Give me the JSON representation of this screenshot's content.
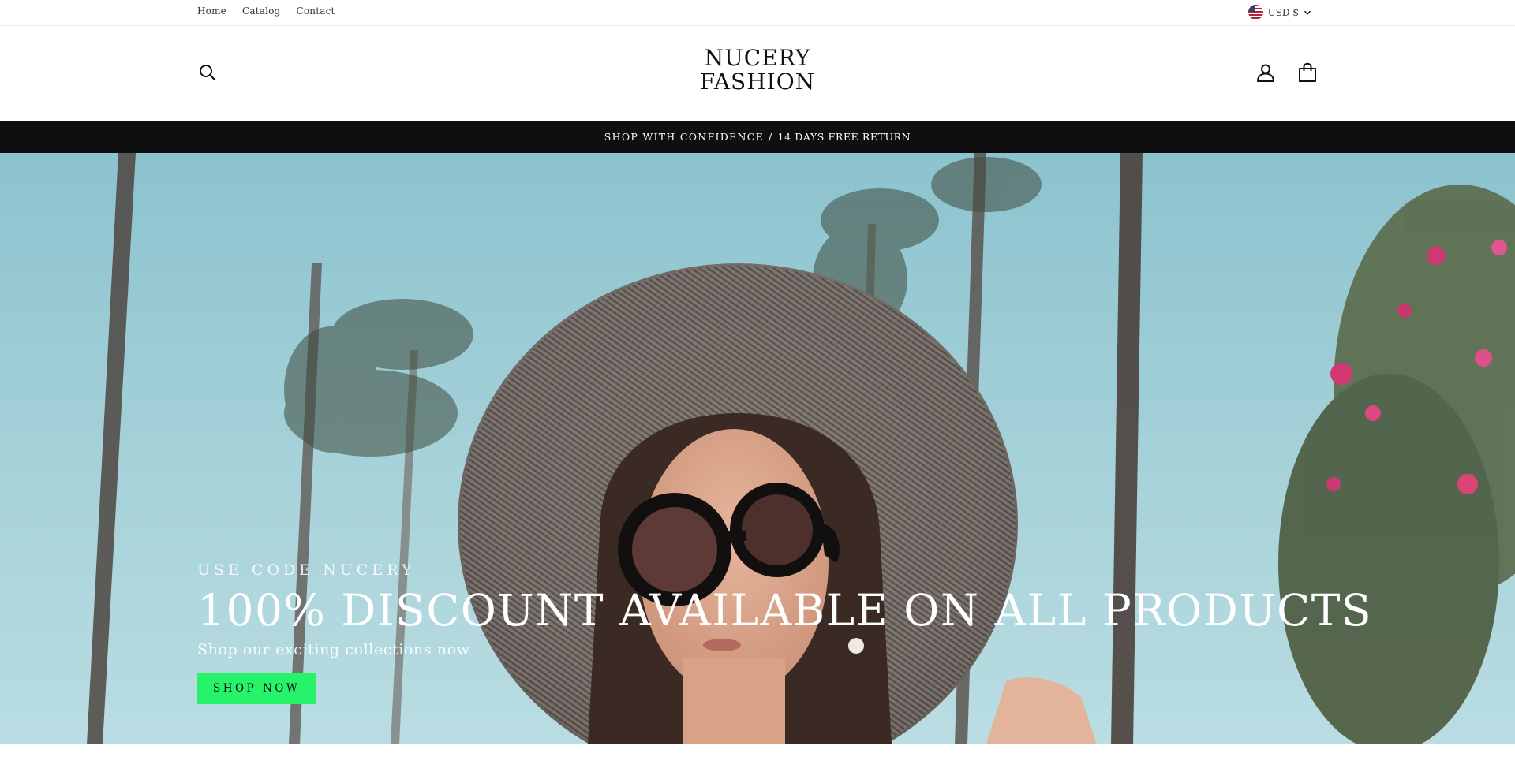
{
  "utility": {
    "nav": [
      "Home",
      "Catalog",
      "Contact"
    ],
    "currency": "USD $"
  },
  "header": {
    "logo_line1": "NUCERY",
    "logo_line2": "FASHION",
    "icons": {
      "search": "search-icon",
      "account": "user-icon",
      "cart": "cart-icon"
    }
  },
  "announcement": {
    "bold": "SHOP WITH CONFIDENCE",
    "separator": "/",
    "light": "14 DAYS FREE RETURN"
  },
  "hero": {
    "kicker": "USE CODE NUCERY",
    "title": "100% DISCOUNT AVAILABLE ON ALL PRODUCTS",
    "subtitle": "Shop our exciting collections now",
    "button": "SHOP NOW",
    "button_color": "#26f26a"
  },
  "colors": {
    "announcement_bg": "#0f0f0f",
    "sky": "#a9d3da"
  }
}
